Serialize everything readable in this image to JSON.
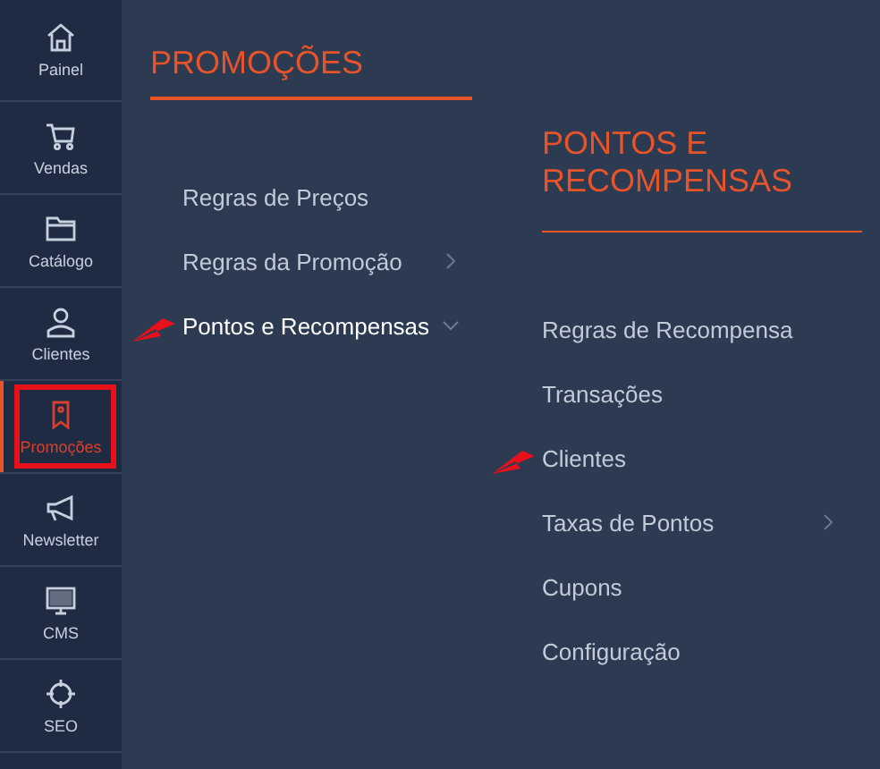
{
  "sidebar": {
    "items": [
      {
        "label": "Painel",
        "kind": "home",
        "selected": false,
        "annotated": false
      },
      {
        "label": "Vendas",
        "kind": "cart",
        "selected": false,
        "annotated": false
      },
      {
        "label": "Catálogo",
        "kind": "folder",
        "selected": false,
        "annotated": false
      },
      {
        "label": "Clientes",
        "kind": "person",
        "selected": false,
        "annotated": false
      },
      {
        "label": "Promoções",
        "kind": "tag",
        "selected": true,
        "annotated": true
      },
      {
        "label": "Newsletter",
        "kind": "megaphone",
        "selected": false,
        "annotated": false
      },
      {
        "label": "CMS",
        "kind": "monitor",
        "selected": false,
        "annotated": false
      },
      {
        "label": "SEO",
        "kind": "target",
        "selected": false,
        "annotated": false
      }
    ]
  },
  "menu": {
    "title": "PROMOÇÕES",
    "items": [
      {
        "label": "Regras de Preços",
        "kind": "link",
        "selected": false,
        "annotated": false
      },
      {
        "label": "Regras da Promoção",
        "kind": "group",
        "expanded": false,
        "selected": false,
        "annotated": false
      },
      {
        "label": "Pontos e Recompensas",
        "kind": "group",
        "expanded": true,
        "selected": true,
        "annotated": true
      }
    ]
  },
  "submenu": {
    "title": "PONTOS E RECOMPENSAS",
    "items": [
      {
        "label": "Regras de Recompensa",
        "kind": "link",
        "annotated": false
      },
      {
        "label": "Transações",
        "kind": "link",
        "annotated": false
      },
      {
        "label": "Clientes",
        "kind": "link",
        "annotated": true
      },
      {
        "label": "Taxas de Pontos",
        "kind": "group",
        "expanded": false,
        "annotated": false
      },
      {
        "label": "Cupons",
        "kind": "link",
        "annotated": false
      },
      {
        "label": "Configuração",
        "kind": "link",
        "annotated": false
      }
    ]
  }
}
